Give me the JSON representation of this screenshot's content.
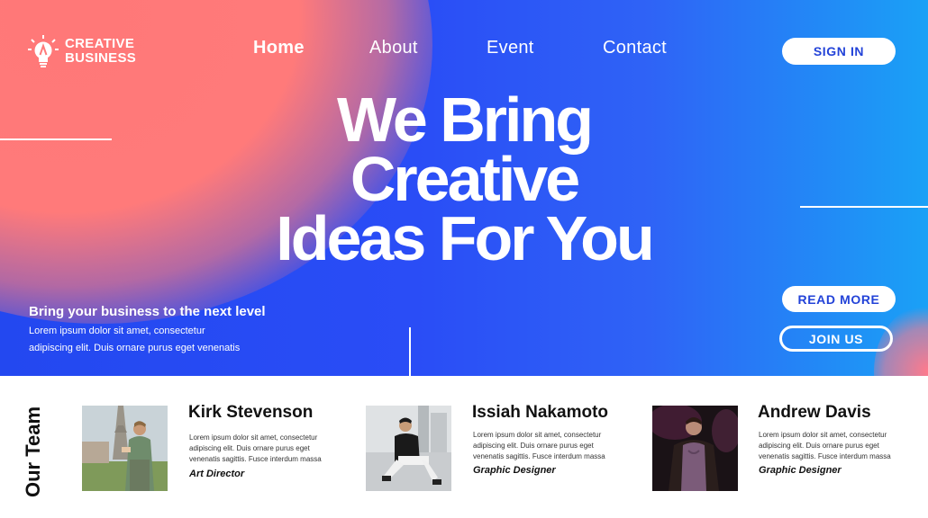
{
  "brand": {
    "line1": "CREATIVE",
    "line2": "BUSINESS",
    "logo_icon": "lightbulb-icon"
  },
  "nav": [
    {
      "label": "Home",
      "active": true
    },
    {
      "label": "About",
      "active": false
    },
    {
      "label": "Event",
      "active": false
    },
    {
      "label": "Contact",
      "active": false
    }
  ],
  "buttons": {
    "sign_in": "SIGN IN",
    "read_more": "READ MORE",
    "join_us": "JOIN US"
  },
  "hero": {
    "headline_lines": [
      "We Bring",
      "Creative",
      "Ideas For You"
    ],
    "subtitle": "Bring your business to the next level",
    "body_lines": [
      "Lorem ipsum dolor sit amet, consectetur",
      "adipiscing elit. Duis ornare purus eget venenatis"
    ]
  },
  "team": {
    "label": "Our Team",
    "members": [
      {
        "name": "Kirk Stevenson",
        "desc": "Lorem ipsum dolor sit amet, consectetur adipiscing elit. Duis ornare purus eget venenatis sagittis. Fusce interdum massa",
        "role": "Art Director"
      },
      {
        "name": "Issiah Nakamoto",
        "desc": "Lorem ipsum dolor sit amet, consectetur adipiscing elit. Duis ornare purus eget venenatis sagittis. Fusce interdum massa",
        "role": "Graphic Designer"
      },
      {
        "name": "Andrew Davis",
        "desc": "Lorem ipsum dolor sit amet, consectetur adipiscing elit. Duis ornare purus eget venenatis sagittis. Fusce interdum massa",
        "role": "Graphic Designer"
      }
    ]
  },
  "colors": {
    "hero_blue": "#2a4df6",
    "hero_pink": "#ff7a7a",
    "hero_cyan": "#1aa1f6",
    "button_text": "#2343d8"
  }
}
